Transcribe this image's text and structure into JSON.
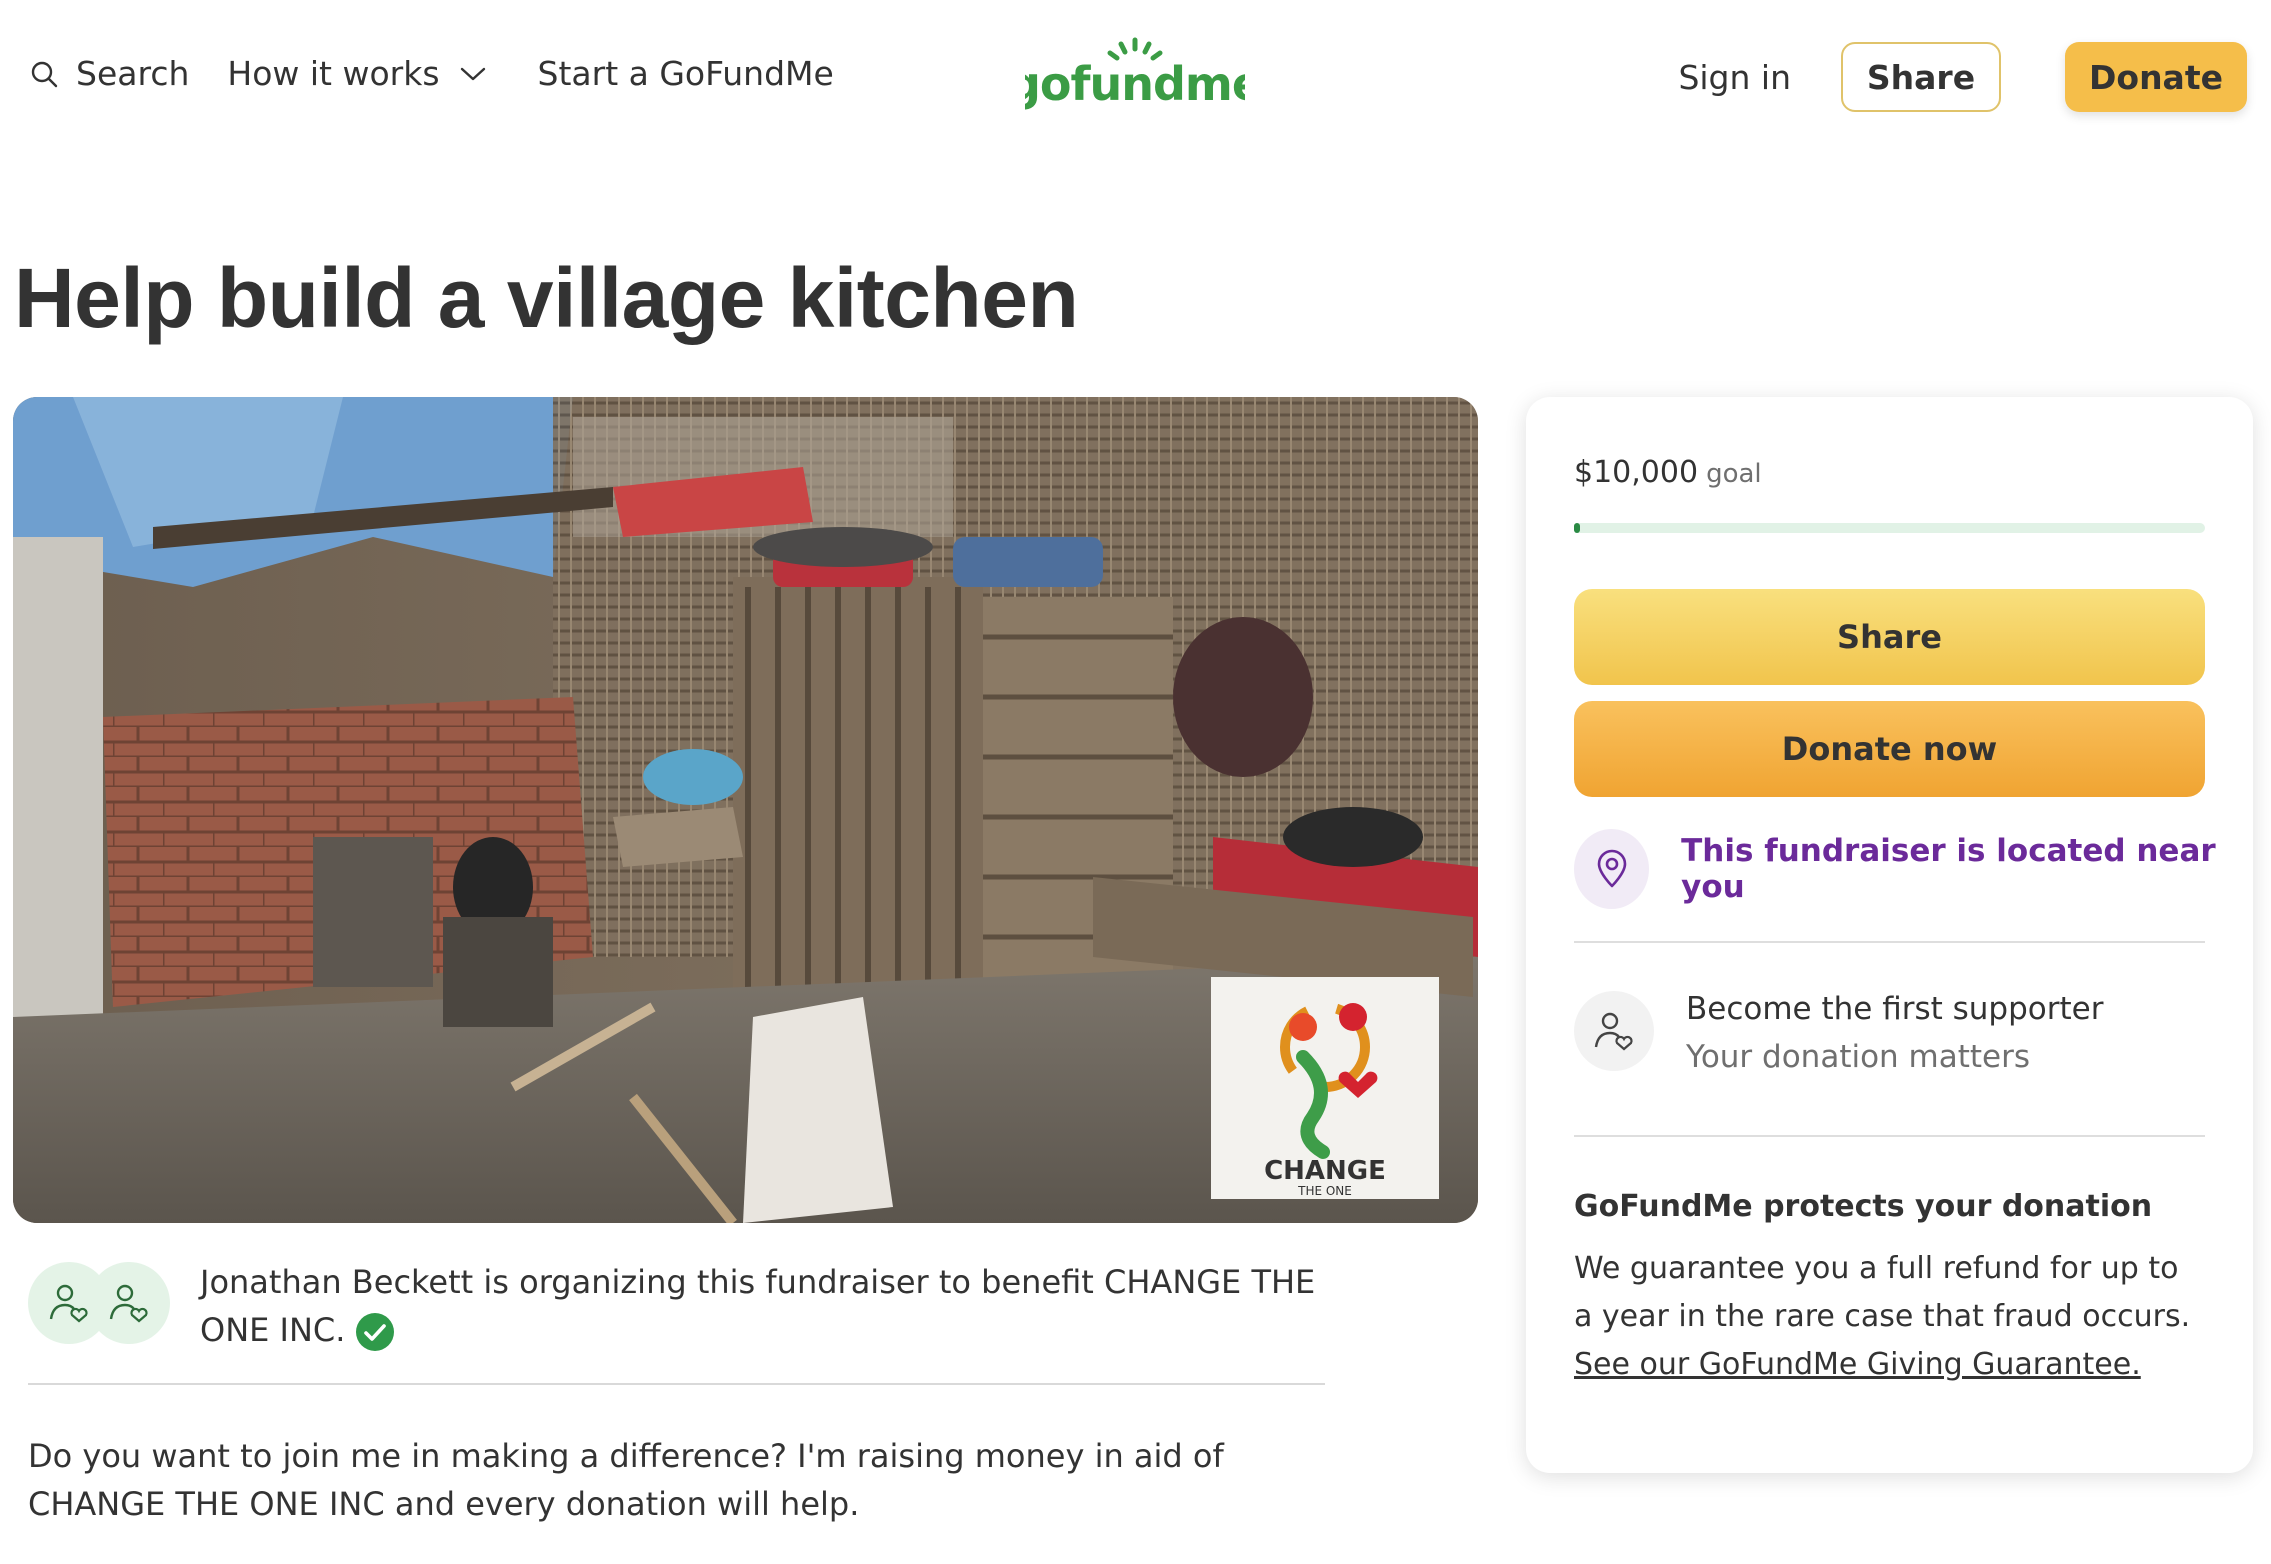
{
  "header": {
    "search_label": "Search",
    "how_it_works_label": "How it works",
    "start_label": "Start a GoFundMe",
    "logo_text": "gofundme",
    "sign_in_label": "Sign in",
    "share_label": "Share",
    "donate_label": "Donate"
  },
  "campaign": {
    "title": "Help build a village kitchen",
    "image_logo_text": "CHANGE",
    "image_logo_subtext": "THE ONE",
    "organizer_text": "Jonathan Beckett is organizing this fundraiser to benefit CHANGE THE ONE INC.",
    "story": "Do you want to join me in making a difference? I'm raising money in aid of CHANGE THE ONE INC and every donation will help."
  },
  "card": {
    "goal_amount": "$10,000",
    "goal_word": "goal",
    "progress_fraction": 0.01,
    "share_label": "Share",
    "donate_now_label": "Donate now",
    "near_you_text": "This fundraiser is located near you",
    "supporter_title": "Become the first supporter",
    "supporter_subtitle": "Your donation matters",
    "protect_title": "GoFundMe protects your donation",
    "protect_body": "We guarantee you a full refund for up to a year in the rare case that fraud occurs.",
    "protect_link": "See our GoFundMe Giving Guarantee."
  },
  "colors": {
    "brand_green": "#3b9c45",
    "donate_yellow": "#f5be4a",
    "near_purple": "#6b2a9a",
    "verified_green": "#2f9a4a"
  },
  "icons": [
    "search-icon",
    "chevron-down-icon",
    "location-pin-icon",
    "supporter-icon",
    "verified-check-icon",
    "organizer-icon"
  ]
}
